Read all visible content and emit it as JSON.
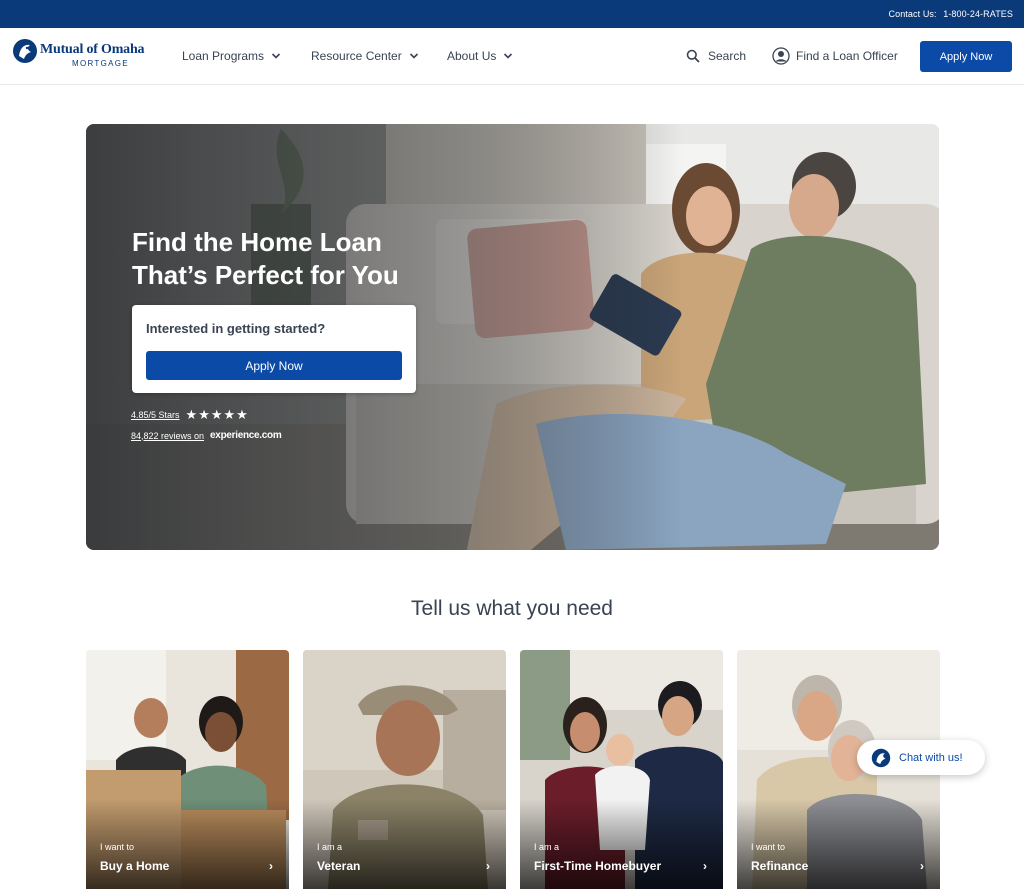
{
  "topbar": {
    "contact_label": "Contact Us:",
    "phone": "1-800-24-RATES"
  },
  "logo": {
    "brand": "Mutual of Omaha",
    "sub": "MORTGAGE"
  },
  "nav": {
    "items": [
      {
        "label": "Loan Programs"
      },
      {
        "label": "Resource Center"
      },
      {
        "label": "About Us"
      }
    ],
    "search_label": "Search",
    "find_officer_label": "Find a Loan Officer",
    "apply_label": "Apply Now"
  },
  "hero": {
    "title_line1": "Find the Home Loan",
    "title_line2": "That’s Perfect for You",
    "cta_question": "Interested in getting started?",
    "cta_button": "Apply Now",
    "rating_text": "4.85/5 Stars",
    "rating_value": 4.85,
    "rating_max": 5,
    "reviews_text": "84,822 reviews on",
    "reviews_source": "experience.com"
  },
  "section": {
    "title": "Tell us what you need"
  },
  "cards": [
    {
      "pre": "I want to",
      "label": "Buy a Home"
    },
    {
      "pre": "I am a",
      "label": "Veteran"
    },
    {
      "pre": "I am a",
      "label": "First-Time Homebuyer"
    },
    {
      "pre": "I want to",
      "label": "Refinance"
    }
  ],
  "chat": {
    "label": "Chat with us!"
  },
  "colors": {
    "brand_navy": "#0b3a7a",
    "button_blue": "#0b4aa6"
  }
}
